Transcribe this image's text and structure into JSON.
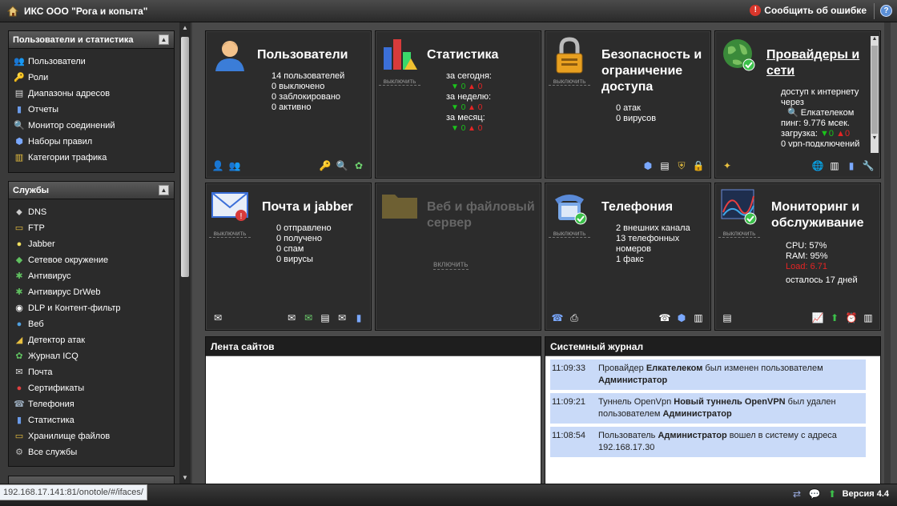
{
  "topbar": {
    "title": "ИКС ООО \"Рога и копыта\"",
    "report_label": "Сообщить об ошибке"
  },
  "sidebar": {
    "users_panel": {
      "title": "Пользователи и статистика",
      "items": [
        {
          "label": "Пользователи",
          "icon": "users-icon"
        },
        {
          "label": "Роли",
          "icon": "key-icon"
        },
        {
          "label": "Диапазоны адресов",
          "icon": "address-book-icon"
        },
        {
          "label": "Отчеты",
          "icon": "report-chart-icon"
        },
        {
          "label": "Монитор соединений",
          "icon": "magnifier-icon"
        },
        {
          "label": "Наборы правил",
          "icon": "rules-icon"
        },
        {
          "label": "Категории трафика",
          "icon": "category-icon"
        }
      ]
    },
    "services_panel": {
      "title": "Службы",
      "items": [
        {
          "label": "DNS",
          "icon": "dns-tag-icon"
        },
        {
          "label": "FTP",
          "icon": "ftp-folder-icon"
        },
        {
          "label": "Jabber",
          "icon": "jabber-bulb-icon"
        },
        {
          "label": "Сетевое окружение",
          "icon": "network-icon"
        },
        {
          "label": "Антивирус",
          "icon": "antivirus-bug-icon"
        },
        {
          "label": "Антивирус DrWeb",
          "icon": "drweb-bug-icon"
        },
        {
          "label": "DLP и Контент-фильтр",
          "icon": "eye-icon"
        },
        {
          "label": "Веб",
          "icon": "globe-icon"
        },
        {
          "label": "Детектор атак",
          "icon": "attack-detector-icon"
        },
        {
          "label": "Журнал ICQ",
          "icon": "icq-flower-icon"
        },
        {
          "label": "Почта",
          "icon": "mail-icon"
        },
        {
          "label": "Сертификаты",
          "icon": "certificate-icon"
        },
        {
          "label": "Телефония",
          "icon": "phone-icon"
        },
        {
          "label": "Статистика",
          "icon": "stats-chart-icon"
        },
        {
          "label": "Хранилище файлов",
          "icon": "folder-icon"
        },
        {
          "label": "Все службы",
          "icon": "gear-icon"
        }
      ]
    }
  },
  "tiles": {
    "users": {
      "title": "Пользователи",
      "lines": [
        "14 пользователей",
        "0 выключено",
        "0 заблокировано",
        "0 активно"
      ]
    },
    "stats": {
      "title": "Статистика",
      "disable": "выключить",
      "periods": [
        {
          "label": "за сегодня:",
          "down": "0",
          "up": "0"
        },
        {
          "label": "за неделю:",
          "down": "0",
          "up": "0"
        },
        {
          "label": "за месяц:",
          "down": "0",
          "up": "0"
        }
      ]
    },
    "security": {
      "title": "Безопасность и ограничение доступа",
      "disable": "выключить",
      "lines": [
        "0 атак",
        "0 вирусов"
      ]
    },
    "providers": {
      "title": "Провайдеры и сети",
      "access_label": "доступ к интернету через",
      "provider": "Елкателеком",
      "ping": "пинг: 9.776 мсек.",
      "load_label": "загрузка:",
      "load_down": "0",
      "load_up": "0",
      "vpn": "0 vpn-подключений"
    },
    "mail": {
      "title": "Почта и jabber",
      "disable": "выключить",
      "lines": [
        "0 отправлено",
        "0 получено",
        "0 спам",
        "0 вирусы"
      ]
    },
    "webfile": {
      "title": "Веб и файловый сервер",
      "enable": "включить"
    },
    "telephony": {
      "title": "Телефония",
      "disable": "выключить",
      "lines": [
        "2 внешних канала",
        "13 телефонных номеров",
        "1 факс"
      ]
    },
    "monitoring": {
      "title": "Мониторинг и обслуживание",
      "disable": "выключить",
      "cpu": "CPU: 57%",
      "ram": "RAM: 95%",
      "load": "Load: 6.71",
      "remaining": "осталось 17 дней"
    }
  },
  "feeds": {
    "sites_title": "Лента сайтов",
    "journal_title": "Системный журнал",
    "journal": [
      {
        "time": "11:09:33",
        "parts": [
          {
            "t": "Провайдер ",
            "b": false
          },
          {
            "t": "Елкателеком",
            "b": true
          },
          {
            "t": " был изменен пользователем ",
            "b": false
          },
          {
            "t": "Администратор",
            "b": true
          }
        ]
      },
      {
        "time": "11:09:21",
        "parts": [
          {
            "t": "Туннель OpenVpn ",
            "b": false
          },
          {
            "t": "Новый туннель OpenVPN",
            "b": true
          },
          {
            "t": " был удален пользователем ",
            "b": false
          },
          {
            "t": "Администратор",
            "b": true
          }
        ]
      },
      {
        "time": "11:08:54",
        "parts": [
          {
            "t": "Пользователь ",
            "b": false
          },
          {
            "t": "Администратор",
            "b": true
          },
          {
            "t": " вошел в систему с адреса 192.168.17.30",
            "b": false
          }
        ]
      }
    ]
  },
  "bottombar": {
    "status_url": "192.168.17.141:81/onotole/#/ifaces/",
    "version": "Версия 4.4"
  },
  "colors": {
    "accent_green": "#1bc41b",
    "accent_red": "#e62424",
    "journal_row_bg": "#c9daf8",
    "tile_bg": "#2c2c2c"
  }
}
